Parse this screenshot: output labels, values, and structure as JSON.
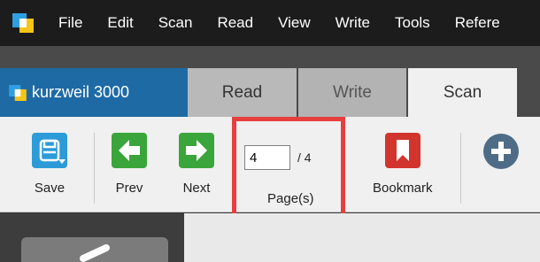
{
  "menu": {
    "items": [
      "File",
      "Edit",
      "Scan",
      "Read",
      "View",
      "Write",
      "Tools",
      "Refere"
    ]
  },
  "brand": {
    "name": "kurzweil 3000"
  },
  "tabs": [
    {
      "label": "Read",
      "active": false
    },
    {
      "label": "Write",
      "active": false
    },
    {
      "label": "Scan",
      "active": true
    }
  ],
  "toolbar": {
    "save_label": "Save",
    "prev_label": "Prev",
    "next_label": "Next",
    "page_value": "4",
    "page_total": "/ 4",
    "pages_label": "Page(s)",
    "bookmark_label": "Bookmark"
  },
  "colors": {
    "save_icon": "#2c9bd8",
    "nav_icons": "#3aa53a",
    "bookmark_icon": "#d2352e",
    "add_icon": "#4e6c86",
    "highlight_border": "#e83e3e",
    "brand_tab": "#1e6aa5"
  },
  "icons": {
    "app": "kurzweil-logo-icon",
    "save": "floppy-disk-icon",
    "prev": "arrow-left-icon",
    "next": "arrow-right-icon",
    "bookmark": "bookmark-icon",
    "add": "plus-circle-icon"
  }
}
